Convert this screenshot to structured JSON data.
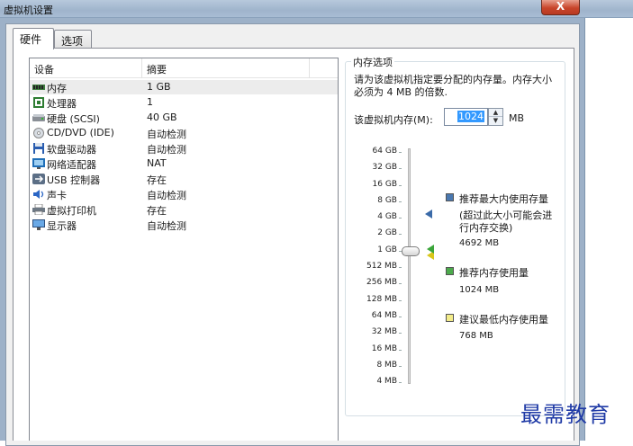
{
  "window": {
    "title": "虚拟机设置",
    "close_label": "X"
  },
  "tabs": [
    {
      "label": "硬件"
    },
    {
      "label": "选项"
    }
  ],
  "device_list": {
    "headers": {
      "device": "设备",
      "summary": "摘要"
    },
    "rows": [
      {
        "name": "内存",
        "summary": "1 GB",
        "icon": "memory-icon"
      },
      {
        "name": "处理器",
        "summary": "1",
        "icon": "processor-icon"
      },
      {
        "name": "硬盘 (SCSI)",
        "summary": "40 GB",
        "icon": "hard-disk-icon"
      },
      {
        "name": "CD/DVD (IDE)",
        "summary": "自动检测",
        "icon": "cd-dvd-icon"
      },
      {
        "name": "软盘驱动器",
        "summary": "自动检测",
        "icon": "floppy-icon"
      },
      {
        "name": "网络适配器",
        "summary": "NAT",
        "icon": "network-adapter-icon"
      },
      {
        "name": "USB 控制器",
        "summary": "存在",
        "icon": "usb-icon"
      },
      {
        "name": "声卡",
        "summary": "自动检测",
        "icon": "sound-card-icon"
      },
      {
        "name": "虚拟打印机",
        "summary": "存在",
        "icon": "printer-icon"
      },
      {
        "name": "显示器",
        "summary": "自动检测",
        "icon": "display-icon"
      }
    ]
  },
  "memory": {
    "group_title": "内存选项",
    "description": "请为该虚拟机指定要分配的内存量。内存大小必须为 4 MB 的倍数.",
    "field_label": "该虚拟机内存(M):",
    "value": "1024",
    "unit": "MB",
    "scale_labels": [
      "64 GB",
      "32 GB",
      "16 GB",
      "8 GB",
      "4 GB",
      "2 GB",
      "1 GB",
      "512 MB",
      "256 MB",
      "128 MB",
      "64 MB",
      "32 MB",
      "16 MB",
      "8 MB",
      "4 MB"
    ],
    "legend": {
      "max": {
        "title": "推荐最大内使用存量",
        "note": "(超过此大小可能会进行内存交换)",
        "value": "4692 MB",
        "color": "#4a78b0"
      },
      "recommended": {
        "title": "推荐内存使用量",
        "value": "1024 MB",
        "color": "#4caa4c"
      },
      "minimum": {
        "title": "建议最低内存使用量",
        "value": "768 MB",
        "color": "#f3ec8a"
      }
    }
  },
  "watermark": "最需教育"
}
